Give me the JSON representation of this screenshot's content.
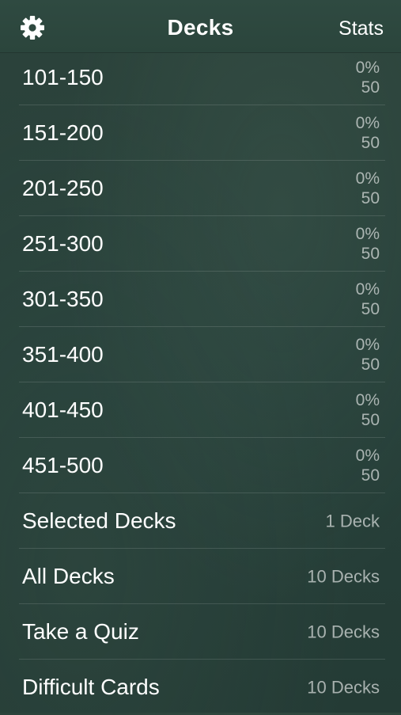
{
  "navbar": {
    "title": "Decks",
    "right_button": "Stats",
    "left_icon": "gear-icon"
  },
  "decks": [
    {
      "label": "101-150",
      "percent": "0%",
      "count": "50"
    },
    {
      "label": "151-200",
      "percent": "0%",
      "count": "50"
    },
    {
      "label": "201-250",
      "percent": "0%",
      "count": "50"
    },
    {
      "label": "251-300",
      "percent": "0%",
      "count": "50"
    },
    {
      "label": "301-350",
      "percent": "0%",
      "count": "50"
    },
    {
      "label": "351-400",
      "percent": "0%",
      "count": "50"
    },
    {
      "label": "401-450",
      "percent": "0%",
      "count": "50"
    },
    {
      "label": "451-500",
      "percent": "0%",
      "count": "50"
    }
  ],
  "actions": [
    {
      "label": "Selected Decks",
      "detail": "1 Deck"
    },
    {
      "label": "All Decks",
      "detail": "10 Decks"
    },
    {
      "label": "Take a Quiz",
      "detail": "10 Decks"
    },
    {
      "label": "Difficult Cards",
      "detail": "10 Decks"
    }
  ],
  "colors": {
    "background": "#27403a",
    "navbar": "#2d473e",
    "text": "#ffffff",
    "secondary_text": "#a9b4af"
  }
}
